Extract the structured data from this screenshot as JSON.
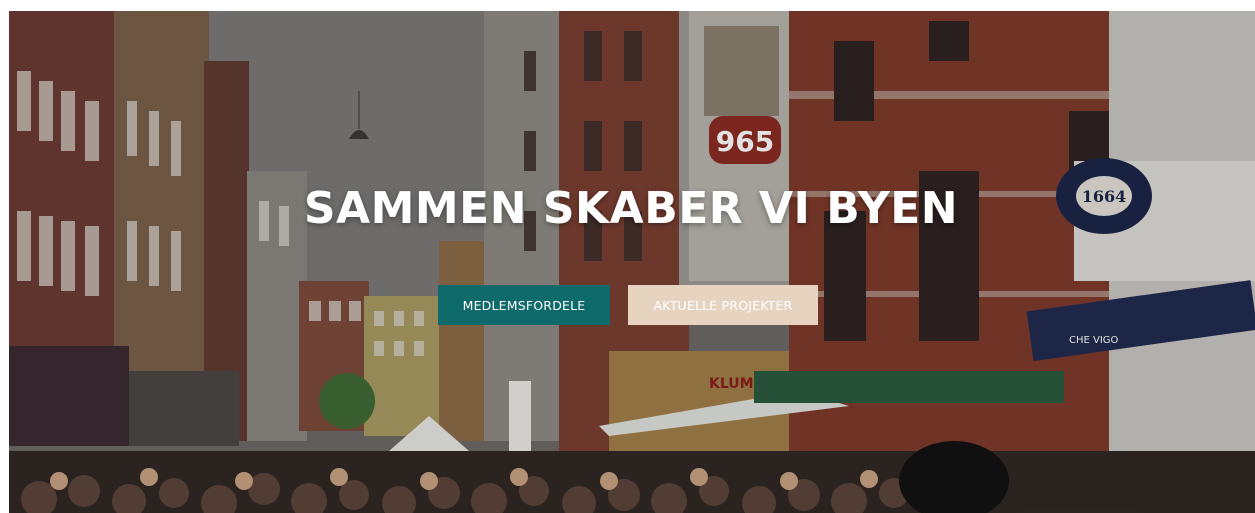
{
  "hero": {
    "headline": "SAMMEN SKABER VI BYEN",
    "buttons": {
      "primary_label": "MEDLEMSFORDELE",
      "secondary_label": "AKTUELLE PROJEKTER"
    },
    "background_signs": {
      "billboard_number": "965",
      "beer_sign": "1664",
      "shop_sign": "KLUM",
      "awning_text": "CHE VIGO"
    }
  },
  "colors": {
    "primary_button": "#0f6a6c",
    "secondary_button": "#e7d4c0",
    "headline": "#ffffff"
  }
}
